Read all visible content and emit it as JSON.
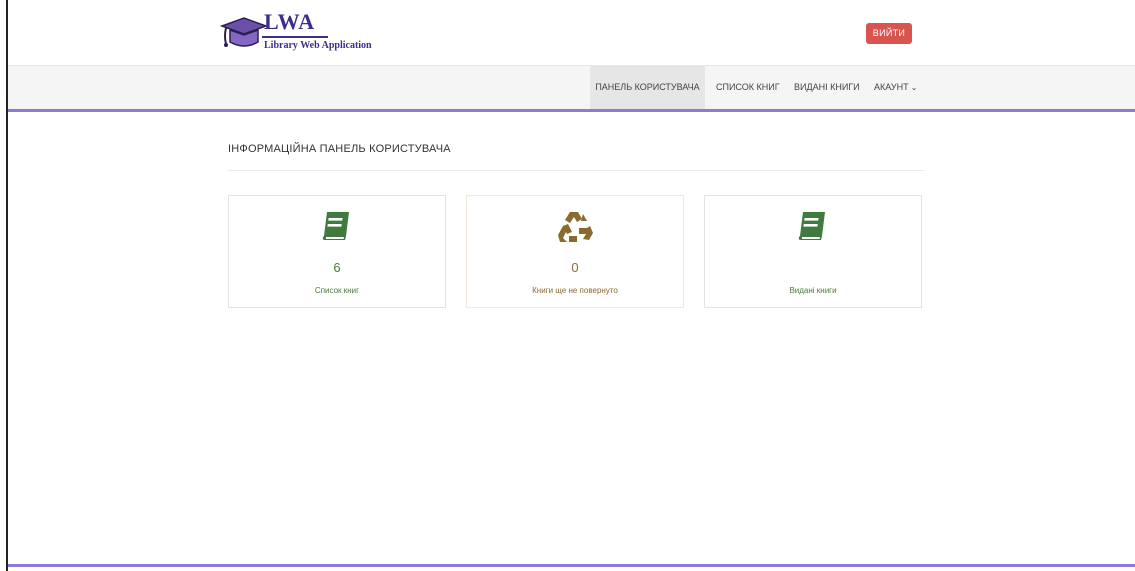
{
  "colors": {
    "accent": "#8f78d8",
    "logout_bg": "#d9534f",
    "book_green": "#3f7a3f",
    "recycle_brown": "#8a6a2e",
    "text_green": "#4b7a3b",
    "text_brown": "#8a6a2e"
  },
  "header": {
    "logo_title": "LWA",
    "logo_subtitle": "Library Web Application",
    "logout_label": "ВИЙТИ"
  },
  "nav": {
    "items": [
      {
        "label": "ПАНЕЛЬ КОРИСТУВАЧА",
        "active": true
      },
      {
        "label": "СПИСОК КНИГ"
      },
      {
        "label": "ВИДАНІ КНИГИ"
      },
      {
        "label": "АКАУНТ",
        "icon": "chevron-down-icon"
      }
    ]
  },
  "main": {
    "title": "ІНФОРМАЦІЙНА ПАНЕЛЬ КОРИСТУВАЧА",
    "cards": [
      {
        "icon": "book-icon",
        "count": "6",
        "label": "Список книг"
      },
      {
        "icon": "recycle-icon",
        "count": "0",
        "label": "Книги ще не повернуто"
      },
      {
        "icon": "book-icon",
        "count": "",
        "label": "Видані книги"
      }
    ]
  }
}
